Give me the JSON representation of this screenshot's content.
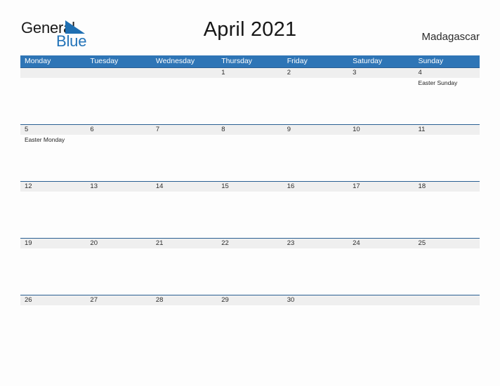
{
  "brand": {
    "name_dark": "General",
    "name_blue": "Blue",
    "flag_icon": "blue-triangle-flag-icon",
    "blue_hex": "#2273b8"
  },
  "header": {
    "title": "April 2021",
    "country": "Madagascar"
  },
  "theme": {
    "header_blue": "#2e75b6",
    "row_band_gray": "#efefef",
    "rule_blue": "#2a5f92",
    "page_background": "#fdfdfd",
    "text_dark": "#2b2b2b"
  },
  "calendar": {
    "month": "April",
    "year": "2021",
    "weekday_headers": [
      "Monday",
      "Tuesday",
      "Wednesday",
      "Thursday",
      "Friday",
      "Saturday",
      "Sunday"
    ],
    "weeks": [
      {
        "days": [
          {
            "num": "",
            "event": ""
          },
          {
            "num": "",
            "event": ""
          },
          {
            "num": "",
            "event": ""
          },
          {
            "num": "1",
            "event": ""
          },
          {
            "num": "2",
            "event": ""
          },
          {
            "num": "3",
            "event": ""
          },
          {
            "num": "4",
            "event": "Easter Sunday"
          }
        ]
      },
      {
        "days": [
          {
            "num": "5",
            "event": "Easter Monday"
          },
          {
            "num": "6",
            "event": ""
          },
          {
            "num": "7",
            "event": ""
          },
          {
            "num": "8",
            "event": ""
          },
          {
            "num": "9",
            "event": ""
          },
          {
            "num": "10",
            "event": ""
          },
          {
            "num": "11",
            "event": ""
          }
        ]
      },
      {
        "days": [
          {
            "num": "12",
            "event": ""
          },
          {
            "num": "13",
            "event": ""
          },
          {
            "num": "14",
            "event": ""
          },
          {
            "num": "15",
            "event": ""
          },
          {
            "num": "16",
            "event": ""
          },
          {
            "num": "17",
            "event": ""
          },
          {
            "num": "18",
            "event": ""
          }
        ]
      },
      {
        "days": [
          {
            "num": "19",
            "event": ""
          },
          {
            "num": "20",
            "event": ""
          },
          {
            "num": "21",
            "event": ""
          },
          {
            "num": "22",
            "event": ""
          },
          {
            "num": "23",
            "event": ""
          },
          {
            "num": "24",
            "event": ""
          },
          {
            "num": "25",
            "event": ""
          }
        ]
      },
      {
        "days": [
          {
            "num": "26",
            "event": ""
          },
          {
            "num": "27",
            "event": ""
          },
          {
            "num": "28",
            "event": ""
          },
          {
            "num": "29",
            "event": ""
          },
          {
            "num": "30",
            "event": ""
          },
          {
            "num": "",
            "event": ""
          },
          {
            "num": "",
            "event": ""
          }
        ]
      }
    ]
  }
}
